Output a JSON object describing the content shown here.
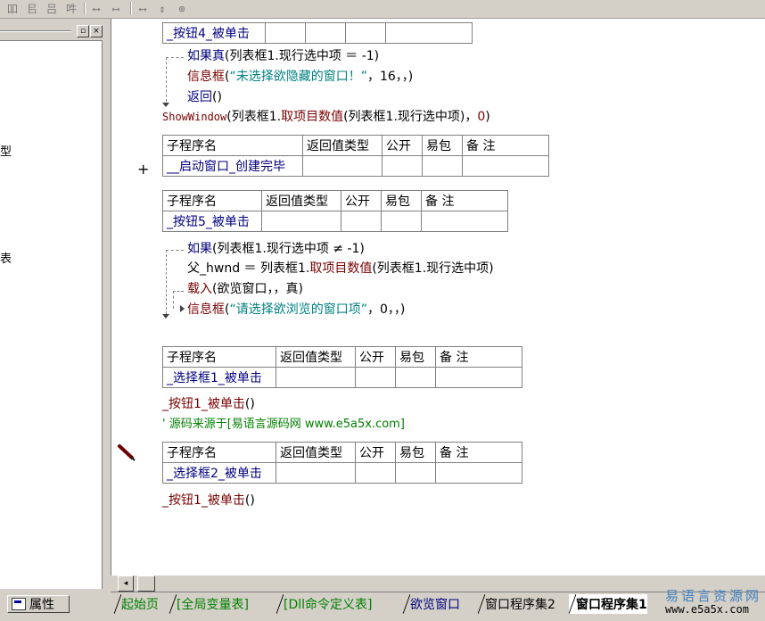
{
  "toolbar": {
    "buttons": [
      "吅",
      "㠯",
      "吕",
      "吽",
      "⟷",
      "⟷",
      "⟷",
      "↕",
      "⊕"
    ]
  },
  "left_panel": {
    "min_glyph": "▫",
    "close_glyph": "×",
    "side_chars": [
      "型",
      "表"
    ],
    "properties_tab": "属性"
  },
  "code": {
    "sub4_table": {
      "name": "_按钮4_被单击"
    },
    "line_if_true": "如果真",
    "line_if_true_args": "(列表框1.现行选中项 ＝ -1)",
    "line_msgbox1_fn": "信息框",
    "line_msgbox1_open": "(",
    "line_msgbox1_str": "“未选择欲隐藏的窗口！”",
    "line_msgbox1_rest": "，16，，)",
    "line_return": "返回",
    "line_return_args": "()",
    "line_showwindow_fn": "ShowWindow",
    "line_showwindow_a": "(列表框1.",
    "line_showwindow_b": "取项目数值",
    "line_showwindow_c": "(列表框1.现行选中项)，",
    "line_showwindow_zero": "0",
    "line_showwindow_d": ")",
    "table_headers_a": [
      "子程序名",
      "返回值类型",
      "公开",
      "易包",
      "备 注"
    ],
    "table_headers_b": [
      "子程序名",
      "返回值类型",
      "公开",
      "易包",
      "备 注"
    ],
    "table_headers_c": [
      "子程序名",
      "返回值类型",
      "公开",
      "易包",
      "备 注"
    ],
    "table_headers_d": [
      "子程序名",
      "返回值类型",
      "公开",
      "易包",
      "备 注"
    ],
    "sub_startup": "__启动窗口_创建完毕",
    "plus_glyph": "+",
    "sub5": "_按钮5_被单击",
    "line_if": "如果",
    "line_if_args": "(列表框1.现行选中项 ≠ -1)",
    "line_assign_a": "父_hwnd ＝ 列表框1.",
    "line_assign_b": "取项目数值",
    "line_assign_c": "(列表框1.现行选中项)",
    "line_load_fn": "载入",
    "line_load_args": "(欲览窗口，，真)",
    "line_msgbox2_fn": "信息框",
    "line_msgbox2_open": "(",
    "line_msgbox2_str": "“请选择欲浏览的窗口项”",
    "line_msgbox2_rest": "，0，，)",
    "sub_sel1": "_选择框1_被单击",
    "call_btn1_a": "_按钮1_被单击",
    "call_btn1_a_args": "()",
    "comment": "' 源码来源于[易语言源码网 www.e5a5x.com]",
    "sub_sel2": "_选择框2_被单击",
    "call_btn1_b": "_按钮1_被单击",
    "call_btn1_b_args": "()"
  },
  "scroll": {
    "left_glyph": "◂"
  },
  "tabs": [
    {
      "label": "起始页"
    },
    {
      "label": "[全局变量表]"
    },
    {
      "label": "[Dll命令定义表]"
    },
    {
      "label": "欲览窗口"
    },
    {
      "label": "窗口程序集2"
    },
    {
      "label": "窗口程序集1"
    }
  ],
  "watermark": {
    "cn": "易语言资源网",
    "url": "www.e5a5x.com"
  }
}
